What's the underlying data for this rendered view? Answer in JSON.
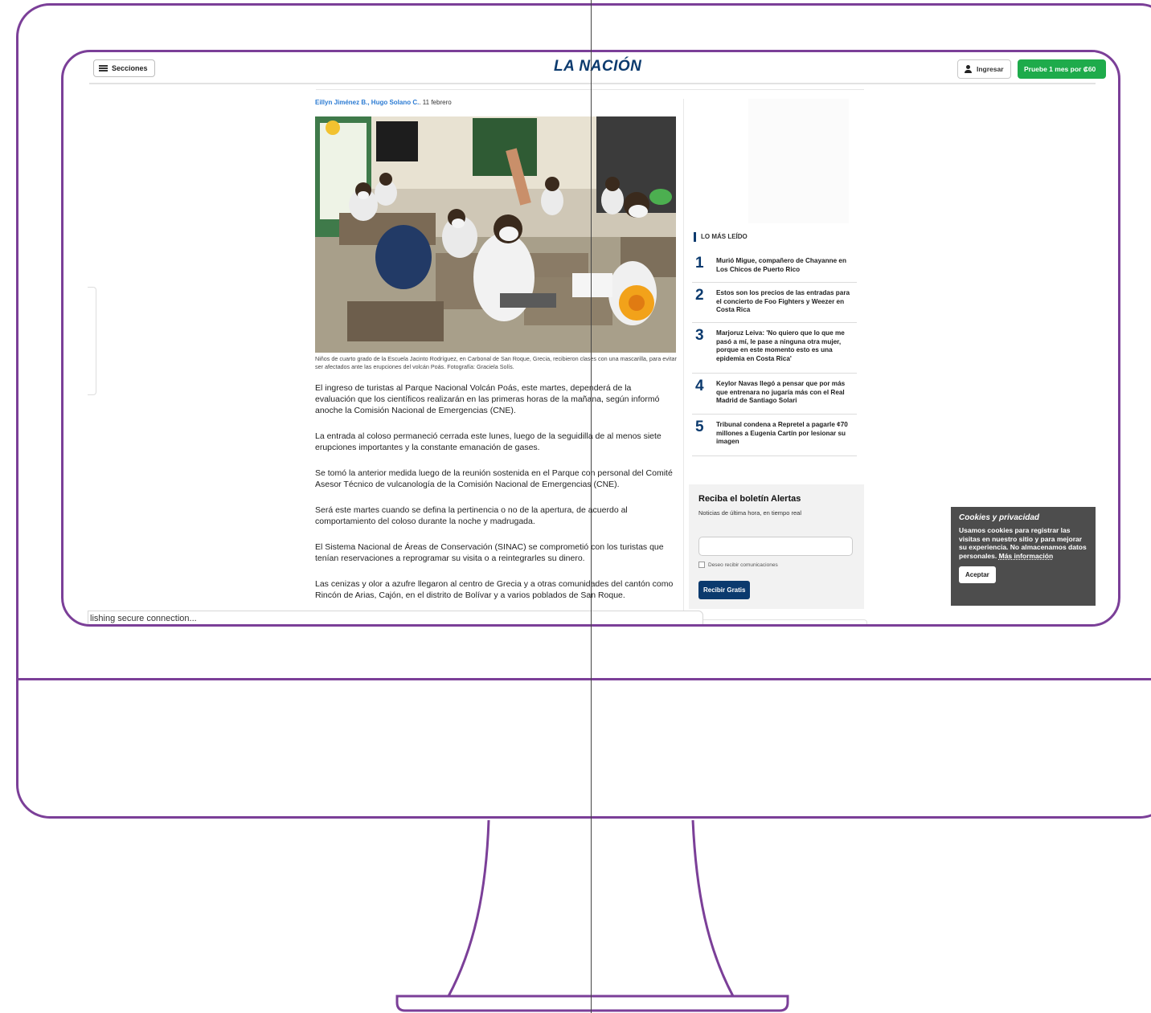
{
  "header": {
    "sections_label": "Secciones",
    "logo_text": "LA NACIÓN",
    "login_label": "Ingresar",
    "trial_label": "Pruebe 1 mes por ₡60"
  },
  "article": {
    "authors": "Eillyn Jiménez B., Hugo Solano C.",
    "date": ". 11 febrero",
    "caption": "Niños de cuarto grado de la Escuela Jacinto Rodríguez, en Carbonal de San Roque, Grecia, recibieron clases con una mascarilla, para evitar ser afectados ante las erupciones del volcán Poás. Fotografía: Graciela Solís.",
    "paragraphs": [
      "El ingreso de turistas al Parque Nacional Volcán Poás, este martes, dependerá de la evaluación que los científicos realizarán en las primeras horas de la mañana, según informó anoche la Comisión Nacional de Emergencias (CNE).",
      "La entrada al coloso permaneció cerrada este lunes, luego de la seguidilla de al menos siete erupciones importantes y la constante emanación de gases.",
      "Se tomó la anterior medida luego de la reunión sostenida en el Parque con personal del Comité Asesor Técnico de vulcanología de la Comisión Nacional de Emergencias (CNE).",
      "Será este martes cuando se defina la pertinencia o no de la apertura, de acuerdo al comportamiento del coloso durante la noche y madrugada.",
      "El Sistema Nacional de Áreas de Conservación (SINAC) se comprometió con los turistas que tenían reservaciones a reprogramar su visita o a reintegrarles su dinero.",
      "Las cenizas y olor a azufre llegaron al centro de Grecia y a otras comunidades del cantón como Rincón de Arias, Cajón, en el distrito de Bolívar y a varios poblados de San Roque."
    ]
  },
  "most_read": {
    "title": "LO MÁS LEÍDO",
    "items": [
      {
        "rank": "1",
        "text": "Murió Migue, compañero de Chayanne en Los Chicos de Puerto Rico"
      },
      {
        "rank": "2",
        "text": "Estos son los precios de las entradas para el concierto de Foo Fighters y Weezer en Costa Rica"
      },
      {
        "rank": "3",
        "text": "Marjoruz Leiva: 'No quiero que lo que me pasó a mí, le pase a ninguna otra mujer, porque en este momento esto es una epidemia en Costa Rica'"
      },
      {
        "rank": "4",
        "text": "Keylor Navas llegó a pensar que por más que entrenara no jugaría más con el Real Madrid de Santiago Solari"
      },
      {
        "rank": "5",
        "text": "Tribunal condena a Repretel a pagarle ¢70 millones a Eugenia Cartín por lesionar su imagen"
      }
    ]
  },
  "newsletter": {
    "title": "Reciba el boletín Alertas",
    "subtitle": "Noticias de última hora, en tiempo real",
    "email_value": "",
    "checkbox_label": "Deseo recibir comunicaciones",
    "button_label": "Recibir Gratis"
  },
  "cookies": {
    "title": "Cookies y privacidad",
    "text": "Usamos cookies para registrar las visitas en nuestro sitio y para mejorar su experiencia. No almacenamos datos personales.",
    "more_label": "Más información",
    "accept_label": "Aceptar"
  },
  "status_bar": {
    "text": "lishing secure connection..."
  },
  "colors": {
    "frame": "#7b3f98",
    "brand_blue": "#0b3a6e",
    "trial_green": "#1eab4b",
    "author_link": "#2b7bd3"
  }
}
